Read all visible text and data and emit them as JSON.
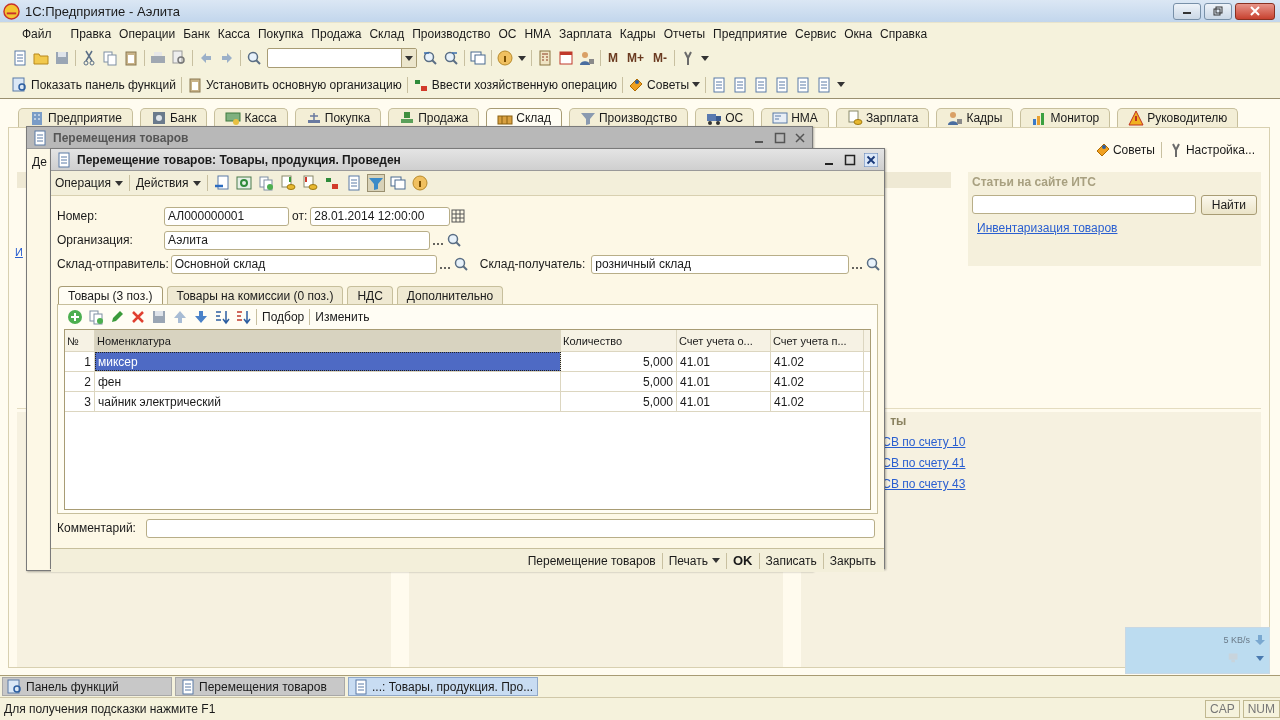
{
  "window": {
    "title": "1С:Предприятие - Аэлита"
  },
  "menu": [
    "Файл",
    "Правка",
    "Операции",
    "Банк",
    "Касса",
    "Покупка",
    "Продажа",
    "Склад",
    "Производство",
    "ОС",
    "НМА",
    "Зарплата",
    "Кадры",
    "Отчеты",
    "Предприятие",
    "Сервис",
    "Окна",
    "Справка"
  ],
  "memory_buttons": [
    "M",
    "M+",
    "M-"
  ],
  "command_bar": [
    {
      "label": "Показать панель функций",
      "kind": "plain"
    },
    {
      "label": "Установить основную организацию",
      "kind": "plain"
    },
    {
      "label": "Ввести хозяйственную операцию",
      "kind": "plain"
    },
    {
      "label": "Советы",
      "kind": "menu"
    }
  ],
  "sections": [
    {
      "label": "Предприятие",
      "selected": false
    },
    {
      "label": "Банк",
      "selected": false
    },
    {
      "label": "Касса",
      "selected": false
    },
    {
      "label": "Покупка",
      "selected": false
    },
    {
      "label": "Продажа",
      "selected": false
    },
    {
      "label": "Склад",
      "selected": true
    },
    {
      "label": "Производство",
      "selected": false
    },
    {
      "label": "ОС",
      "selected": false
    },
    {
      "label": "НМА",
      "selected": false
    },
    {
      "label": "Зарплата",
      "selected": false
    },
    {
      "label": "Кадры",
      "selected": false
    },
    {
      "label": "Монитор",
      "selected": false
    },
    {
      "label": "Руководителю",
      "selected": false
    }
  ],
  "function_panel": {
    "tips": "Советы",
    "settings": "Настройка...",
    "left_link": "И",
    "its": {
      "title": "Статьи на сайте ИТС",
      "button": "Найти",
      "link": "Инвентаризация товаров"
    },
    "reports_header": "ты",
    "report_links": [
      "СВ по счету 10",
      "СВ по счету 41",
      "СВ по счету 43"
    ]
  },
  "list_window": {
    "title": "Перемещения товаров",
    "toolbar_text": "Де"
  },
  "document": {
    "title": "Перемещение товаров: Товары, продукция. Проведен",
    "toolbar_menus": [
      "Операция",
      "Действия"
    ],
    "number": {
      "label": "Номер:",
      "value": "АЛ000000001"
    },
    "date": {
      "label": "от:",
      "value": "28.01.2014 12:00:00"
    },
    "organization": {
      "label": "Организация:",
      "value": "Аэлита"
    },
    "sender": {
      "label": "Склад-отправитель:",
      "value": "Основной склад"
    },
    "receiver": {
      "label": "Склад-получатель:",
      "value": "розничный склад"
    },
    "tabs": [
      {
        "label": "Товары (3 поз.)",
        "selected": true
      },
      {
        "label": "Товары на комиссии (0 поз.)",
        "selected": false
      },
      {
        "label": "НДС",
        "selected": false
      },
      {
        "label": "Дополнительно",
        "selected": false
      }
    ],
    "table_toolbar": [
      "Подбор",
      "Изменить"
    ],
    "table": {
      "columns": [
        "№",
        "Номенклатура",
        "Количество",
        "Счет учета о...",
        "Счет учета п..."
      ],
      "rows": [
        {
          "number": "1",
          "item": "миксер",
          "quantity": "5,000",
          "account_1": "41.01",
          "account_2": "41.02",
          "selected": true
        },
        {
          "number": "2",
          "item": "фен",
          "quantity": "5,000",
          "account_1": "41.01",
          "account_2": "41.02",
          "selected": false
        },
        {
          "number": "3",
          "item": "чайник электрический",
          "quantity": "5,000",
          "account_1": "41.01",
          "account_2": "41.02",
          "selected": false
        }
      ]
    },
    "comment": {
      "label": "Комментарий:"
    },
    "footer": [
      {
        "label": "Перемещение товаров",
        "kind": "plain"
      },
      {
        "label": "Печать",
        "kind": "menu"
      },
      {
        "label": "OK",
        "kind": "default"
      },
      {
        "label": "Записать",
        "kind": "plain"
      },
      {
        "label": "Закрыть",
        "kind": "plain"
      }
    ]
  },
  "traffic_widget": {
    "speed": "5 KB/s"
  },
  "taskbar": [
    {
      "label": "Панель функций",
      "selected": false
    },
    {
      "label": "Перемещения товаров",
      "selected": false
    },
    {
      "label": "...: Товары, продукция. Про...",
      "selected": true
    }
  ],
  "status_bar": {
    "hint": "Для получения подсказки нажмите F1",
    "indicators": [
      "CAP",
      "NUM"
    ]
  }
}
